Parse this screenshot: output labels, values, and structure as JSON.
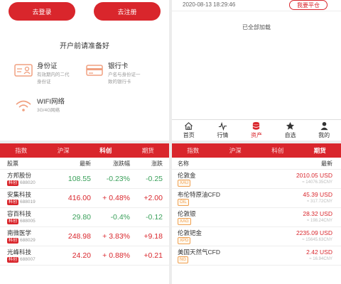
{
  "login_panel": {
    "login_label": "去登录",
    "register_label": "去注册",
    "prepare_title": "开户前请准备好",
    "requirements": [
      {
        "title": "身份证",
        "desc1": "有效期内的二代",
        "desc2": "身份证",
        "icon": "id-card-icon"
      },
      {
        "title": "银行卡",
        "desc1": "户名与身份证一",
        "desc2": "致的银行卡",
        "icon": "bank-card-icon"
      },
      {
        "title": "WIFI网络",
        "desc1": "3G/4G网络",
        "desc2": "",
        "icon": "wifi-icon"
      }
    ]
  },
  "record_panel": {
    "timestamp": "2020-08-13 18:29:46",
    "tag": "我要平仓",
    "loaded_text": "已全部加载",
    "nav": [
      {
        "label": "首页",
        "icon": "home-icon"
      },
      {
        "label": "行情",
        "icon": "pulse-icon"
      },
      {
        "label": "资产",
        "icon": "database-icon"
      },
      {
        "label": "自选",
        "icon": "star-icon"
      },
      {
        "label": "我的",
        "icon": "user-icon"
      }
    ]
  },
  "stock_panel": {
    "tabs": [
      "指数",
      "沪深",
      "科创",
      "期货"
    ],
    "active_tab": 2,
    "headers": [
      "股票",
      "最新",
      "涨跌幅",
      "涨跌"
    ],
    "rows": [
      {
        "name": "方邦股份",
        "badge": "科创",
        "code": "688020",
        "price": "108.55",
        "pct": "-0.23%",
        "chg": "-0.25",
        "dir": "down"
      },
      {
        "name": "安集科技",
        "badge": "科创",
        "code": "688019",
        "price": "416.00",
        "pct": "+ 0.48%",
        "chg": "+2.00",
        "dir": "up"
      },
      {
        "name": "容百科技",
        "badge": "科创",
        "code": "688005",
        "price": "29.80",
        "pct": "-0.4%",
        "chg": "-0.12",
        "dir": "down"
      },
      {
        "name": "南微医学",
        "badge": "科创",
        "code": "688029",
        "price": "248.98",
        "pct": "+ 3.83%",
        "chg": "+9.18",
        "dir": "up"
      },
      {
        "name": "光峰科技",
        "badge": "科创",
        "code": "688007",
        "price": "24.20",
        "pct": "+ 0.88%",
        "chg": "+0.21",
        "dir": "up"
      }
    ]
  },
  "futures_panel": {
    "tabs": [
      "指数",
      "沪深",
      "科创",
      "期货"
    ],
    "active_tab": 3,
    "headers": [
      "名称",
      "最新"
    ],
    "rows": [
      {
        "name": "伦敦金",
        "code": "XAU",
        "usd": "2010.05 USD",
        "cny": "≈ 14076.35CNY"
      },
      {
        "name": "布伦特原油CFD",
        "code": "OIL",
        "usd": "45.39 USD",
        "cny": "≈ 317.72CNY"
      },
      {
        "name": "伦敦银",
        "code": "XAG",
        "usd": "28.32 USD",
        "cny": "≈ 198.24CNY"
      },
      {
        "name": "伦敦钯金",
        "code": "XPD",
        "usd": "2235.09 USD",
        "cny": "≈ 15645.63CNY"
      },
      {
        "name": "美国天然气CFD",
        "code": "NG",
        "usd": "2.42 USD",
        "cny": "≈ 16.94CNY"
      }
    ]
  }
}
